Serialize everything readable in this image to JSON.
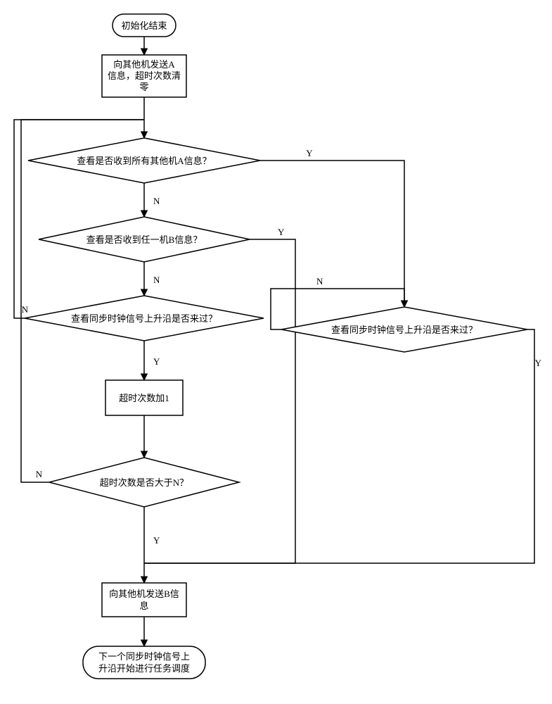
{
  "chart_data": {
    "type": "flowchart",
    "title": "",
    "nodes": [
      {
        "id": "start",
        "shape": "terminator",
        "text": "初始化结束"
      },
      {
        "id": "sendA",
        "shape": "process",
        "text": "向其他机发送A信息，超时次数清零"
      },
      {
        "id": "decA",
        "shape": "decision",
        "text": "查看是否收到所有其他机A信息？"
      },
      {
        "id": "decB",
        "shape": "decision",
        "text": "查看是否收到任一机B信息？"
      },
      {
        "id": "decClkL",
        "shape": "decision",
        "text": "查看同步时钟信号上升沿是否来过？"
      },
      {
        "id": "incTO",
        "shape": "process",
        "text": "超时次数加1"
      },
      {
        "id": "decN",
        "shape": "decision",
        "text": "超时次数是否大于N？"
      },
      {
        "id": "decClkR",
        "shape": "decision",
        "text": "查看同步时钟信号上升沿是否来过？"
      },
      {
        "id": "sendB",
        "shape": "process",
        "text": "向其他机发送B信息"
      },
      {
        "id": "end",
        "shape": "terminator",
        "text": "下一个同步时钟信号上升沿开始进行任务调度"
      }
    ],
    "edges": [
      {
        "from": "start",
        "to": "sendA",
        "label": ""
      },
      {
        "from": "sendA",
        "to": "decA",
        "label": ""
      },
      {
        "from": "decA",
        "to": "decClkR",
        "label": "Y"
      },
      {
        "from": "decA",
        "to": "decB",
        "label": "N"
      },
      {
        "from": "decB",
        "to": "sendB",
        "label": "Y"
      },
      {
        "from": "decB",
        "to": "decClkL",
        "label": "N"
      },
      {
        "from": "decClkL",
        "to": "incTO",
        "label": "Y"
      },
      {
        "from": "decClkL",
        "to": "decA",
        "label": "N"
      },
      {
        "from": "incTO",
        "to": "decN",
        "label": ""
      },
      {
        "from": "decN",
        "to": "sendB",
        "label": "Y"
      },
      {
        "from": "decN",
        "to": "decA",
        "label": "N"
      },
      {
        "from": "decClkR",
        "to": "sendB",
        "label": "Y"
      },
      {
        "from": "decClkR",
        "to": "decClkR",
        "label": "N"
      },
      {
        "from": "sendB",
        "to": "end",
        "label": ""
      }
    ]
  },
  "labels": {
    "Y": "Y",
    "N": "N"
  },
  "nodes": {
    "start_l1": "初始化结束",
    "sendA_l1": "向其他机发送A",
    "sendA_l2": "信息，超时次数清",
    "sendA_l3": "零",
    "decA": "查看是否收到所有其他机A信息？",
    "decB": "查看是否收到任一机B信息？",
    "decClkL": "查看同步时钟信号上升沿是否来过？",
    "incTO": "超时次数加1",
    "decN": "超时次数是否大于N？",
    "decClkR": "查看同步时钟信号上升沿是否来过？",
    "sendB_l1": "向其他机发送B信",
    "sendB_l2": "息",
    "end_l1": "下一个同步时钟信号上",
    "end_l2": "升沿开始进行任务调度"
  }
}
